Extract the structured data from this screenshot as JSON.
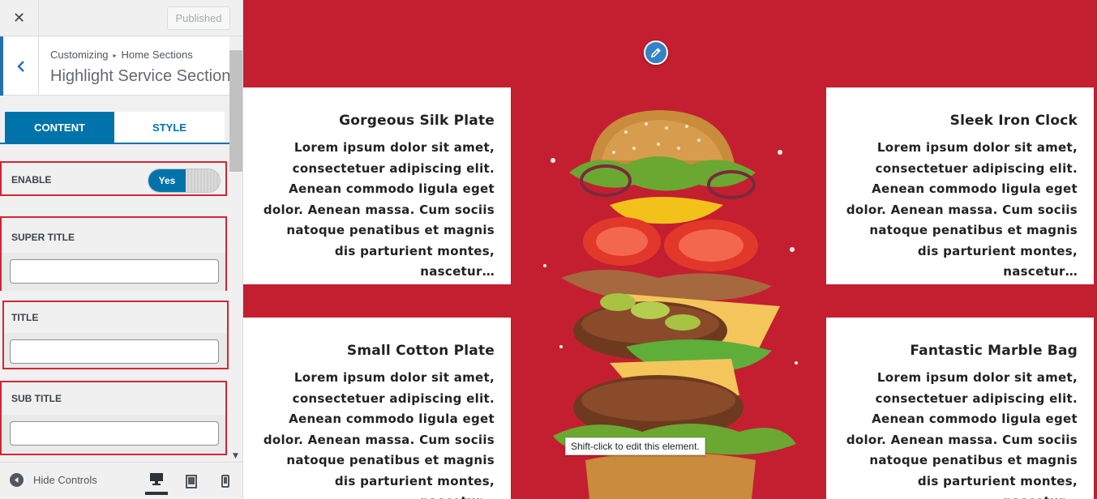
{
  "top_bar": {
    "close_glyph": "✕",
    "published_label": "Published"
  },
  "section_header": {
    "breadcrumb_root": "Customizing",
    "breadcrumb_separator": "▸",
    "breadcrumb_current": "Home Sections",
    "title": "Highlight Service Section"
  },
  "tabs": {
    "content_label": "CONTENT",
    "style_label": "STYLE",
    "active": "CONTENT"
  },
  "fields": {
    "enable_label": "ENABLE",
    "enable_value": "Yes",
    "super_title_label": "SUPER TITLE",
    "super_title_value": "",
    "title_label": "TITLE",
    "title_value": "",
    "sub_title_label": "SUB TITLE",
    "sub_title_value": ""
  },
  "footer": {
    "hide_controls_label": "Hide Controls",
    "active_device": "desktop"
  },
  "preview": {
    "tooltip": "Shift-click to edit this element.",
    "background_color": "#c41f30",
    "cards": [
      {
        "title": "Gorgeous Silk Plate",
        "text": "Lorem ipsum dolor sit amet, consectetuer adipiscing elit. Aenean commodo ligula eget dolor. Aenean massa. Cum sociis natoque penatibus et magnis dis parturient montes, nascetur…"
      },
      {
        "title": "Sleek Iron Clock",
        "text": "Lorem ipsum dolor sit amet, consectetuer adipiscing elit. Aenean commodo ligula eget dolor. Aenean massa. Cum sociis natoque penatibus et magnis dis parturient montes, nascetur…"
      },
      {
        "title": "Small Cotton Plate",
        "text": "Lorem ipsum dolor sit amet, consectetuer adipiscing elit. Aenean commodo ligula eget dolor. Aenean massa. Cum sociis natoque penatibus et magnis dis parturient montes, nascetur…"
      },
      {
        "title": "Fantastic Marble Bag",
        "text": "Lorem ipsum dolor sit amet, consectetuer adipiscing elit. Aenean commodo ligula eget dolor. Aenean massa. Cum sociis natoque penatibus et magnis dis parturient montes, nascetur…"
      }
    ]
  },
  "colors": {
    "accent": "#0073aa",
    "highlight_border": "#d62332"
  }
}
